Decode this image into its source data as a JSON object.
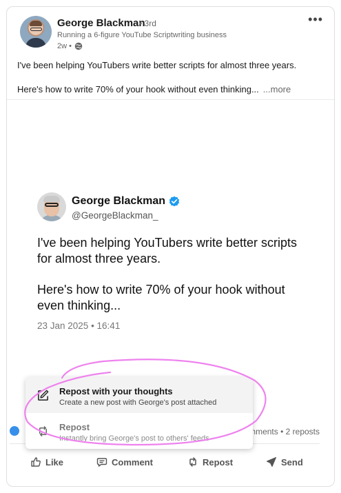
{
  "post": {
    "author_name": "George Blackman",
    "degree": "• 3rd",
    "headline": "Running a 6-figure YouTube Scriptwriting business",
    "age": "2w •",
    "text_line1": "I've been helping YouTubers write better scripts for almost three years.",
    "text_line2": "Here's how to write 70% of your hook without even thinking...",
    "see_more": "...more"
  },
  "tweet": {
    "name": "George Blackman",
    "handle": "@GeorgeBlackman_",
    "body_p1": "I've been helping YouTubers  write better scripts for almost three years.",
    "body_p2": "Here's how to write 70% of your hook without even thinking...",
    "date": "23 Jan 2025 • 16:41"
  },
  "stats": {
    "comments_reposts": "mments • 2 reposts"
  },
  "actions": {
    "like": "Like",
    "comment": "Comment",
    "repost": "Repost",
    "send": "Send"
  },
  "repost_menu": {
    "items": [
      {
        "title": "Repost with your thoughts",
        "desc": "Create a new post with George's post attached"
      },
      {
        "title": "Repost",
        "desc": "Instantly bring George's post to others' feeds"
      }
    ]
  },
  "colors": {
    "linkedin_blue": "#378fe9",
    "annotation_pink": "#ee82ee",
    "verified_blue": "#1d9bf0"
  },
  "icons": [
    "more-icon",
    "globe-icon",
    "verified-icon",
    "like-icon",
    "comment-icon",
    "repost-icon",
    "send-icon",
    "edit-icon"
  ]
}
